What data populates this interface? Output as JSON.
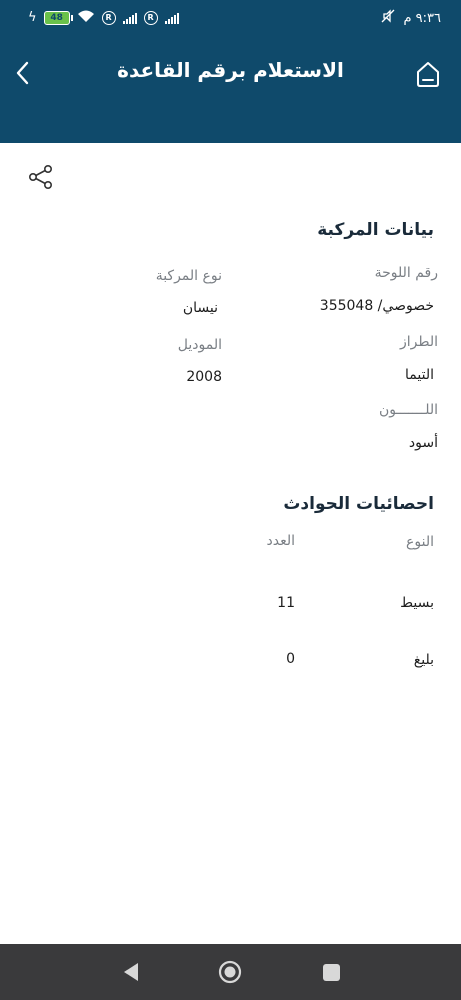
{
  "status_bar": {
    "time": "٩:٣٦ م",
    "battery": "48"
  },
  "header": {
    "title": "الاستعلام برقم القاعدة"
  },
  "vehicle": {
    "section_title": "بيانات المركبة",
    "plate_label": "رقم اللوحة",
    "plate_value": "خصوصي/ 355048",
    "type_label": "نوع المركبة",
    "type_value": "نيسان",
    "model_label": "الطراز",
    "model_value": "التيما",
    "year_label": "الموديل",
    "year_value": "2008",
    "color_label": "اللـــــــون",
    "color_value": "أسود"
  },
  "accidents": {
    "section_title": "احصائيات الحوادث",
    "col_type": "النوع",
    "col_count": "العدد",
    "rows": [
      {
        "type": "بسيط",
        "count": "11"
      },
      {
        "type": "بليغ",
        "count": "0"
      }
    ]
  },
  "icons": {
    "back": "chevron-left-icon",
    "home": "home-icon",
    "share": "share-icon"
  }
}
